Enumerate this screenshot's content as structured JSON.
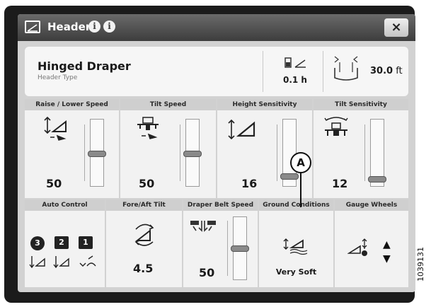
{
  "window": {
    "title": "Header",
    "close_label": "×"
  },
  "summary": {
    "header_type": "Hinged Draper",
    "header_type_caption": "Header Type",
    "hours": "0.1 h",
    "width_value": "30.0",
    "width_unit": " ft"
  },
  "controls_top": [
    {
      "label": "Raise / Lower Speed",
      "value": "50",
      "icon": "raise-lower-speed-icon",
      "level": 0.5
    },
    {
      "label": "Tilt Speed",
      "value": "50",
      "icon": "tilt-speed-icon",
      "level": 0.5
    },
    {
      "label": "Height Sensitivity",
      "value": "16",
      "icon": "height-sensitivity-icon",
      "level": 0.16
    },
    {
      "label": "Tilt Sensitivity",
      "value": "12",
      "icon": "tilt-sensitivity-icon",
      "level": 0.12
    }
  ],
  "controls_bottom": [
    {
      "label": "Auto Control",
      "icon": "auto-control-icon",
      "badges": [
        "3",
        "2",
        "1"
      ]
    },
    {
      "label": "Fore/Aft Tilt",
      "value": "4.5",
      "icon": "fore-aft-tilt-icon"
    },
    {
      "label": "Draper Belt Speed",
      "value": "50",
      "icon": "draper-belt-speed-icon",
      "level": 0.5
    },
    {
      "label": "Ground Conditions",
      "value": "Very Soft",
      "icon": "ground-conditions-icon"
    },
    {
      "label": "Gauge Wheels",
      "icon": "gauge-wheels-icon"
    }
  ],
  "callout": "A",
  "figure_number": "1039131",
  "colors": {
    "bezel": "#1b1b1b",
    "title_bar": "#4a4a4a",
    "panel": "#f2f2f2",
    "panel_header": "#cfcfcf"
  }
}
